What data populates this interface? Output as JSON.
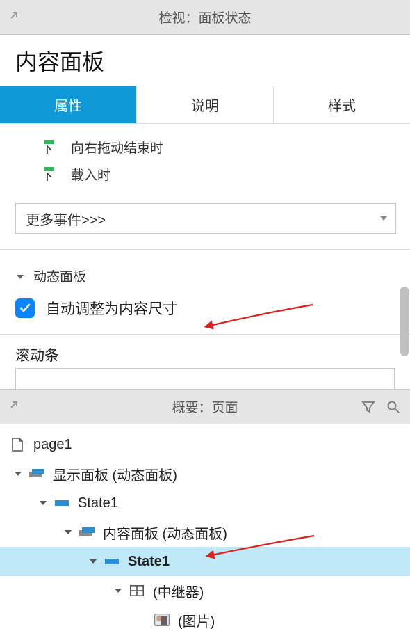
{
  "inspector": {
    "header": "检视：面板状态",
    "widget_name": "内容面板",
    "tabs": [
      {
        "id": "properties",
        "label": "属性",
        "active": true
      },
      {
        "id": "notes",
        "label": "说明",
        "active": false
      },
      {
        "id": "style",
        "label": "样式",
        "active": false
      }
    ],
    "events": [
      {
        "id": "on-swipe-right-end",
        "label": "向右拖动结束时"
      },
      {
        "id": "on-load",
        "label": "载入时"
      }
    ],
    "more_events_label": "更多事件>>>",
    "section_title": "动态面板",
    "fit_to_content": {
      "checked": true,
      "label": "自动调整为内容尺寸"
    },
    "scrollbars_label": "滚动条"
  },
  "outline": {
    "header": "概要：页面",
    "tree": {
      "page": {
        "label": "page1"
      },
      "dp1": {
        "label": "显示面板 (动态面板)"
      },
      "dp1_state1": {
        "label": "State1"
      },
      "dp2": {
        "label": "内容面板 (动态面板)"
      },
      "dp2_state1": {
        "label": "State1"
      },
      "repeater": {
        "label": "(中继器)"
      },
      "image": {
        "label": "(图片)"
      }
    }
  },
  "colors": {
    "accent": "#0f9ad7",
    "checkbox": "#0a84ff",
    "selection": "#bfe9f7",
    "arrow": "#d22"
  }
}
